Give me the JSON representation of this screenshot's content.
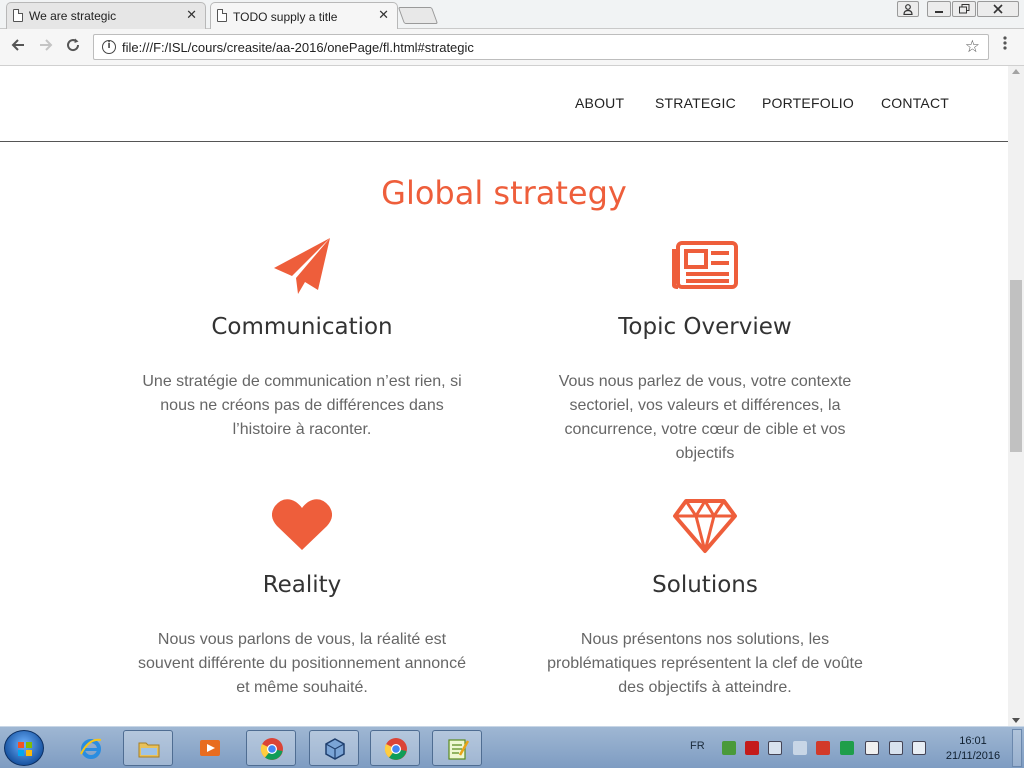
{
  "browser": {
    "tabs": [
      {
        "title": "We are strategic",
        "active": false
      },
      {
        "title": "TODO supply a title",
        "active": true
      }
    ],
    "tab_close": "✕",
    "url": "file:///F:/ISL/cours/creasite/aa-2016/onePage/fl.html#strategic"
  },
  "site": {
    "nav": [
      "ABOUT",
      "STRATEGIC",
      "PORTEFOLIO",
      "CONTACT"
    ],
    "section_title": "Global strategy",
    "accent_color": "#ee5e3b",
    "features": [
      {
        "icon": "paper-plane-icon",
        "title": "Communication",
        "text_lines": [
          "Une stratégie de communication n’est rien, si",
          "nous ne créons pas de différences dans",
          "l’histoire à raconter."
        ]
      },
      {
        "icon": "newspaper-icon",
        "title": "Topic Overview",
        "text_lines": [
          "Vous nous parlez de vous, votre contexte",
          "sectoriel, vos valeurs et différences, la",
          "concurrence, votre cœur de cible et vos",
          "objectifs"
        ]
      },
      {
        "icon": "heart-icon",
        "title": "Reality",
        "text_lines": [
          "Nous vous parlons de vous, la réalité est",
          "souvent différente du positionnement annoncé",
          "et même souhaité."
        ]
      },
      {
        "icon": "diamond-icon",
        "title": "Solutions",
        "text_lines": [
          "Nous présentons nos solutions, les",
          "problématiques représentent la clef de voûte",
          "des objectifs à atteindre."
        ]
      }
    ]
  },
  "taskbar": {
    "lang": "FR",
    "time": "16:01",
    "date": "21/11/2016"
  }
}
